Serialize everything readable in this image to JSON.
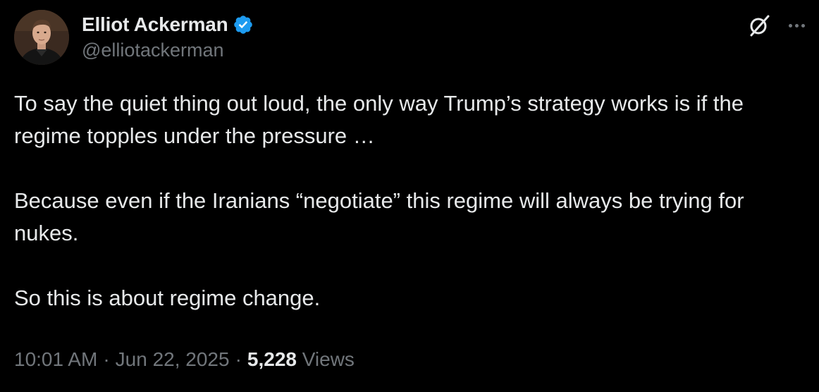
{
  "author": {
    "display_name": "Elliot Ackerman",
    "handle": "@elliotackerman",
    "verified": true,
    "avatar_icon": "profile-photo"
  },
  "actions": {
    "grok_icon": "grok-icon",
    "more_icon": "more-horizontal-icon"
  },
  "tweet": {
    "paragraphs": [
      "To say the quiet thing out loud, the only way Trump’s strategy works is if the regime topples under the pressure …",
      "Because even if the Iranians “negotiate” this regime will always be trying for nukes.",
      "So this is about regime change."
    ]
  },
  "meta": {
    "time": "10:01 AM",
    "separator": "·",
    "date": "Jun 22, 2025",
    "views_count": "5,228",
    "views_label": "Views"
  },
  "colors": {
    "background": "#000000",
    "primary_text": "#e7e9ea",
    "secondary_text": "#71767b",
    "verified_blue": "#1d9bf0"
  }
}
